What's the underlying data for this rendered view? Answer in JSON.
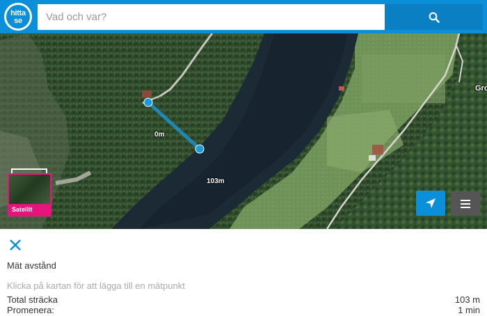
{
  "search": {
    "placeholder": "Vad och var?"
  },
  "logo": {
    "line1": "hitta",
    "line2": "se"
  },
  "map": {
    "marker_start_label": "0m",
    "marker_end_label": "103m",
    "place_label": "Gro",
    "satellite_label": "Satellit"
  },
  "panel": {
    "title": "Mät avstånd",
    "hint": "Klicka på kartan för att lägga till en mätpunkt",
    "rows": [
      {
        "label": "Total sträcka",
        "value": "103 m"
      },
      {
        "label": "Promenera:",
        "value": "1 min"
      }
    ]
  },
  "colors": {
    "brand": "#0a8fd8",
    "satellite_accent": "#e6157d",
    "measure_line": "#1a9be0"
  },
  "icons": {
    "search": "search-icon",
    "locate": "location-arrow-icon",
    "menu": "hamburger-menu-icon",
    "close": "close-icon"
  }
}
